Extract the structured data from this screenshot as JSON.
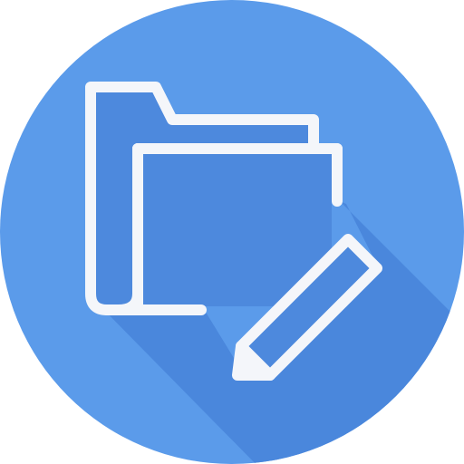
{
  "icon": {
    "name": "edit-folder-icon",
    "colors": {
      "circle": "#5B9BEA",
      "shadow": "#4A87DC",
      "folder_fill": "#4D89DD",
      "stroke": "#F4F6FA"
    }
  }
}
